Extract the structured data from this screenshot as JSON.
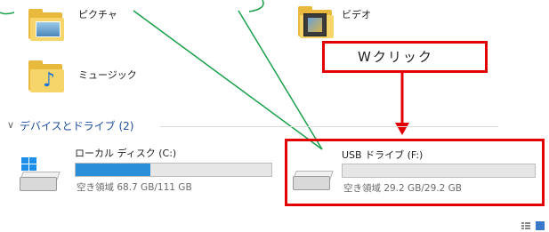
{
  "folders": {
    "pictures": {
      "label": "ピクチャ",
      "icon": "pictures-folder-icon"
    },
    "videos": {
      "label": "ビデオ",
      "icon": "videos-folder-icon"
    },
    "music": {
      "label": "ミュージック",
      "icon": "music-folder-icon"
    }
  },
  "section": {
    "title": "デバイスとドライブ (2)",
    "chevron": "chevron-down-icon"
  },
  "drives": [
    {
      "name": "ローカル ディスク (C:)",
      "space": "空き領域 68.7 GB/111 GB",
      "used_fraction": 0.38,
      "icon": "hard-drive-icon"
    },
    {
      "name": "USB ドライブ (F:)",
      "space": "空き領域 29.2 GB/29.2 GB",
      "used_fraction": 0.0,
      "icon": "usb-drive-icon"
    }
  ],
  "annotation": {
    "callout_text": "Wクリック",
    "highlight_color": "#e30000",
    "line_color": "#1aa04a"
  },
  "colors": {
    "progress_fill": "#2a8fd8",
    "section_text": "#1f4e9e"
  }
}
